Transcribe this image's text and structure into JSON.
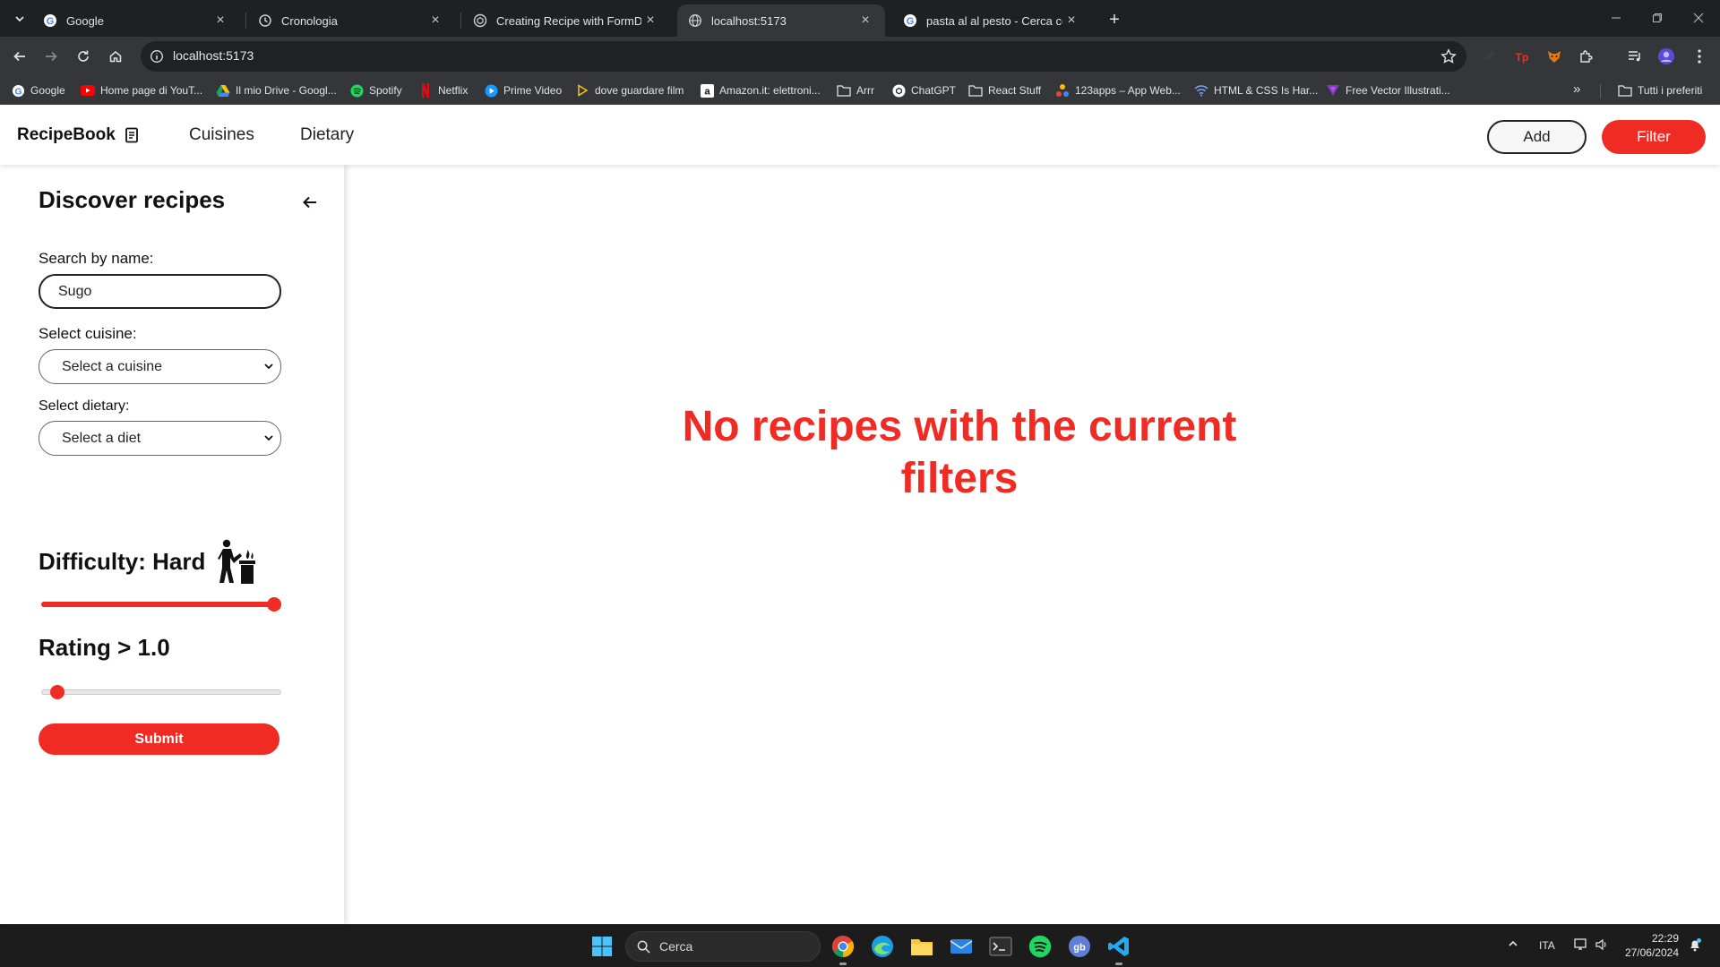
{
  "browser": {
    "tabs": [
      {
        "title": "Google",
        "icon": "google-icon",
        "active": false
      },
      {
        "title": "Cronologia",
        "icon": "history-icon",
        "active": false
      },
      {
        "title": "Creating Recipe with FormData",
        "icon": "chatgpt-icon",
        "active": false
      },
      {
        "title": "localhost:5173",
        "icon": "globe-icon",
        "active": true
      },
      {
        "title": "pasta al al pesto - Cerca con Go",
        "icon": "google-icon",
        "active": false
      }
    ],
    "url": "localhost:5173",
    "bookmarks": [
      {
        "label": "Google",
        "icon": "google-icon"
      },
      {
        "label": "Home page di YouT...",
        "icon": "youtube-icon"
      },
      {
        "label": "Il mio Drive - Googl...",
        "icon": "drive-icon"
      },
      {
        "label": "Spotify",
        "icon": "spotify-icon"
      },
      {
        "label": "Netflix",
        "icon": "netflix-icon"
      },
      {
        "label": "Prime Video",
        "icon": "prime-video-icon"
      },
      {
        "label": "dove guardare film",
        "icon": "play-icon"
      },
      {
        "label": "Amazon.it: elettroni...",
        "icon": "amazon-icon"
      },
      {
        "label": "Arrr",
        "icon": "folder-icon"
      },
      {
        "label": "ChatGPT",
        "icon": "chatgpt-icon"
      },
      {
        "label": "React Stuff",
        "icon": "folder-icon"
      },
      {
        "label": "123apps – App Web...",
        "icon": "apps-icon"
      },
      {
        "label": "HTML & CSS Is Har...",
        "icon": "wifi-icon"
      },
      {
        "label": "Free Vector Illustrati...",
        "icon": "vector-icon"
      }
    ],
    "all_bookmarks_label": "Tutti i preferiti"
  },
  "header": {
    "brand": "RecipeBook",
    "nav": [
      "Cuisines",
      "Dietary"
    ],
    "add_label": "Add",
    "filter_label": "Filter"
  },
  "sidebar": {
    "title": "Discover recipes",
    "search_label": "Search by name:",
    "search_value": "Sugo",
    "cuisine_label": "Select cuisine:",
    "cuisine_selected": "Select a cuisine",
    "dietary_label": "Select dietary:",
    "dietary_selected": "Select a diet",
    "difficulty_text": "Difficulty: Hard",
    "difficulty_level": 1.0,
    "rating_text": "Rating > 1.0",
    "rating_level": 0.04,
    "submit_label": "Submit"
  },
  "main": {
    "empty_message": "No recipes with the current filters"
  },
  "taskbar": {
    "search_placeholder": "Cerca",
    "language": "ITA",
    "time": "22:29",
    "date": "27/06/2024"
  },
  "colors": {
    "accent": "#ef2b24",
    "chrome_dark": "#1f2022",
    "chrome_toolbar": "#35363a"
  }
}
